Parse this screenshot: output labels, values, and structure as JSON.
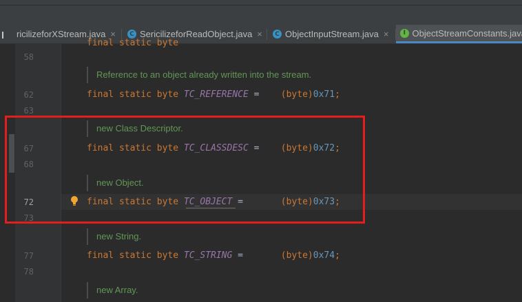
{
  "tabs": [
    {
      "label": "ricilizeforXStream.java",
      "icon": "none",
      "active": false
    },
    {
      "label": "SericilizeforReadObject.java",
      "icon": "class-icon",
      "active": false
    },
    {
      "label": "ObjectInputStream.java",
      "icon": "class-icon",
      "active": false
    },
    {
      "label": "ObjectStreamConstants.java",
      "icon": "interface-icon",
      "active": true
    }
  ],
  "tab_close_glyph": "×",
  "icon_letters": {
    "class": "C",
    "interface": "I"
  },
  "line_numbers": {
    "l58": "58",
    "l62": "62",
    "l63": "63",
    "l67": "67",
    "l68": "68",
    "l72": "72",
    "l73": "73",
    "l77": "77",
    "l78": "78"
  },
  "docs": {
    "reference": "Reference to an object already written into the stream.",
    "classdesc": "new Class Descriptor.",
    "object": "new Object.",
    "string": "new String.",
    "array": "new Array."
  },
  "code": {
    "keywords": "final static byte",
    "assign": "=",
    "cast": "(byte)",
    "reference": {
      "name": "TC_REFERENCE",
      "value": "0x71",
      "end": ";"
    },
    "classdesc": {
      "name": "TC_CLASSDESC",
      "value": "0x72",
      "end": ";"
    },
    "object": {
      "name": "TC_OBJECT",
      "value": "0x73",
      "end": ";"
    },
    "string": {
      "name": "TC_STRING",
      "value": "0x74",
      "end": ";"
    }
  },
  "colors": {
    "keyword": "#cc7832",
    "constant": "#9876aa",
    "number": "#6897bb",
    "doc": "#629755",
    "highlight_box": "#e41d1d"
  }
}
